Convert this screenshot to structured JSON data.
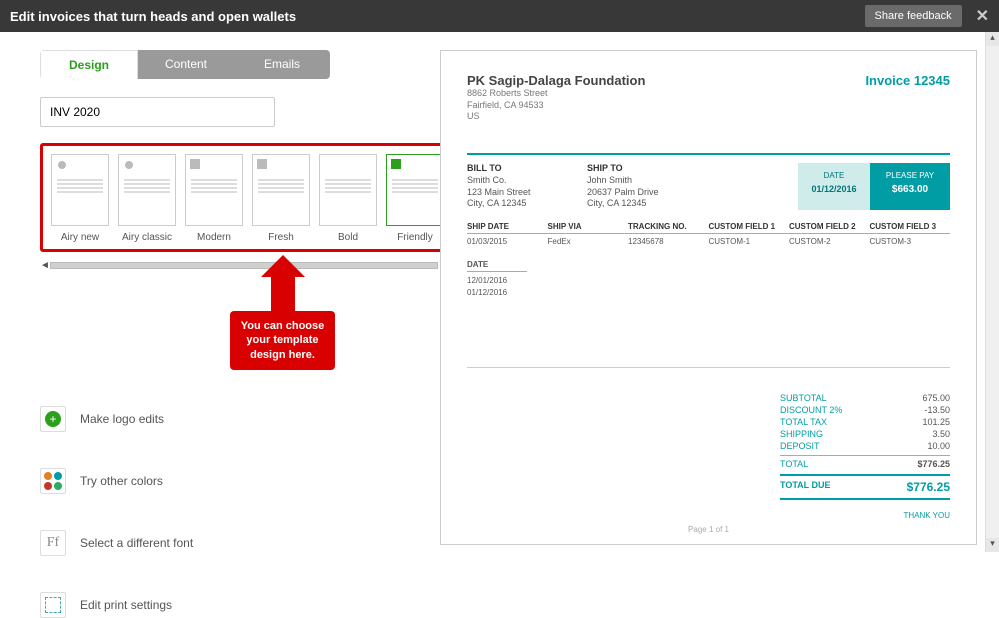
{
  "header": {
    "title": "Edit invoices that turn heads and open wallets",
    "share": "Share feedback"
  },
  "tabs": {
    "design": "Design",
    "content": "Content",
    "emails": "Emails"
  },
  "name_input": "INV 2020",
  "templates": [
    {
      "label": "Airy new",
      "shape": "dot"
    },
    {
      "label": "Airy classic",
      "shape": "dot"
    },
    {
      "label": "Modern",
      "shape": "sq"
    },
    {
      "label": "Fresh",
      "shape": "sq"
    },
    {
      "label": "Bold",
      "shape": "none"
    },
    {
      "label": "Friendly",
      "shape": "sq",
      "selected": true
    }
  ],
  "callout": "You can choose your template design here.",
  "options": {
    "logo": "Make logo edits",
    "colors": "Try other colors",
    "font": "Select a different font",
    "print": "Edit print settings"
  },
  "preview": {
    "company": "PK Sagip-Dalaga Foundation",
    "addr1": "8862 Roberts Street",
    "addr2": "Fairfield, CA 94533",
    "addr3": "US",
    "invoice": "Invoice 12345",
    "billto": {
      "h": "BILL TO",
      "l1": "Smith Co.",
      "l2": "123 Main Street",
      "l3": "City, CA 12345"
    },
    "shipto": {
      "h": "SHIP TO",
      "l1": "John Smith",
      "l2": "20637 Palm Drive",
      "l3": "City, CA 12345"
    },
    "datebox": {
      "l": "DATE",
      "v": "01/12/2016"
    },
    "paybox": {
      "l": "PLEASE PAY",
      "v": "$663.00"
    },
    "cols": [
      {
        "h": "SHIP DATE",
        "v": "01/03/2015"
      },
      {
        "h": "SHIP VIA",
        "v": "FedEx"
      },
      {
        "h": "TRACKING NO.",
        "v": "12345678"
      },
      {
        "h": "CUSTOM FIELD 1",
        "v": "CUSTOM-1"
      },
      {
        "h": "CUSTOM FIELD 2",
        "v": "CUSTOM-2"
      },
      {
        "h": "CUSTOM FIELD 3",
        "v": "CUSTOM-3"
      }
    ],
    "dates": {
      "h": "DATE",
      "d1": "12/01/2016",
      "d2": "01/12/2016"
    },
    "totals": {
      "subtotal": {
        "k": "SUBTOTAL",
        "v": "675.00"
      },
      "discount": {
        "k": "DISCOUNT 2%",
        "v": "-13.50"
      },
      "tax": {
        "k": "TOTAL TAX",
        "v": "101.25"
      },
      "ship": {
        "k": "SHIPPING",
        "v": "3.50"
      },
      "deposit": {
        "k": "DEPOSIT",
        "v": "10.00"
      },
      "total": {
        "k": "TOTAL",
        "v": "$776.25"
      },
      "due": {
        "k": "TOTAL DUE",
        "v": "$776.25"
      }
    },
    "thanks": "THANK YOU",
    "pager": "Page 1 of 1"
  }
}
